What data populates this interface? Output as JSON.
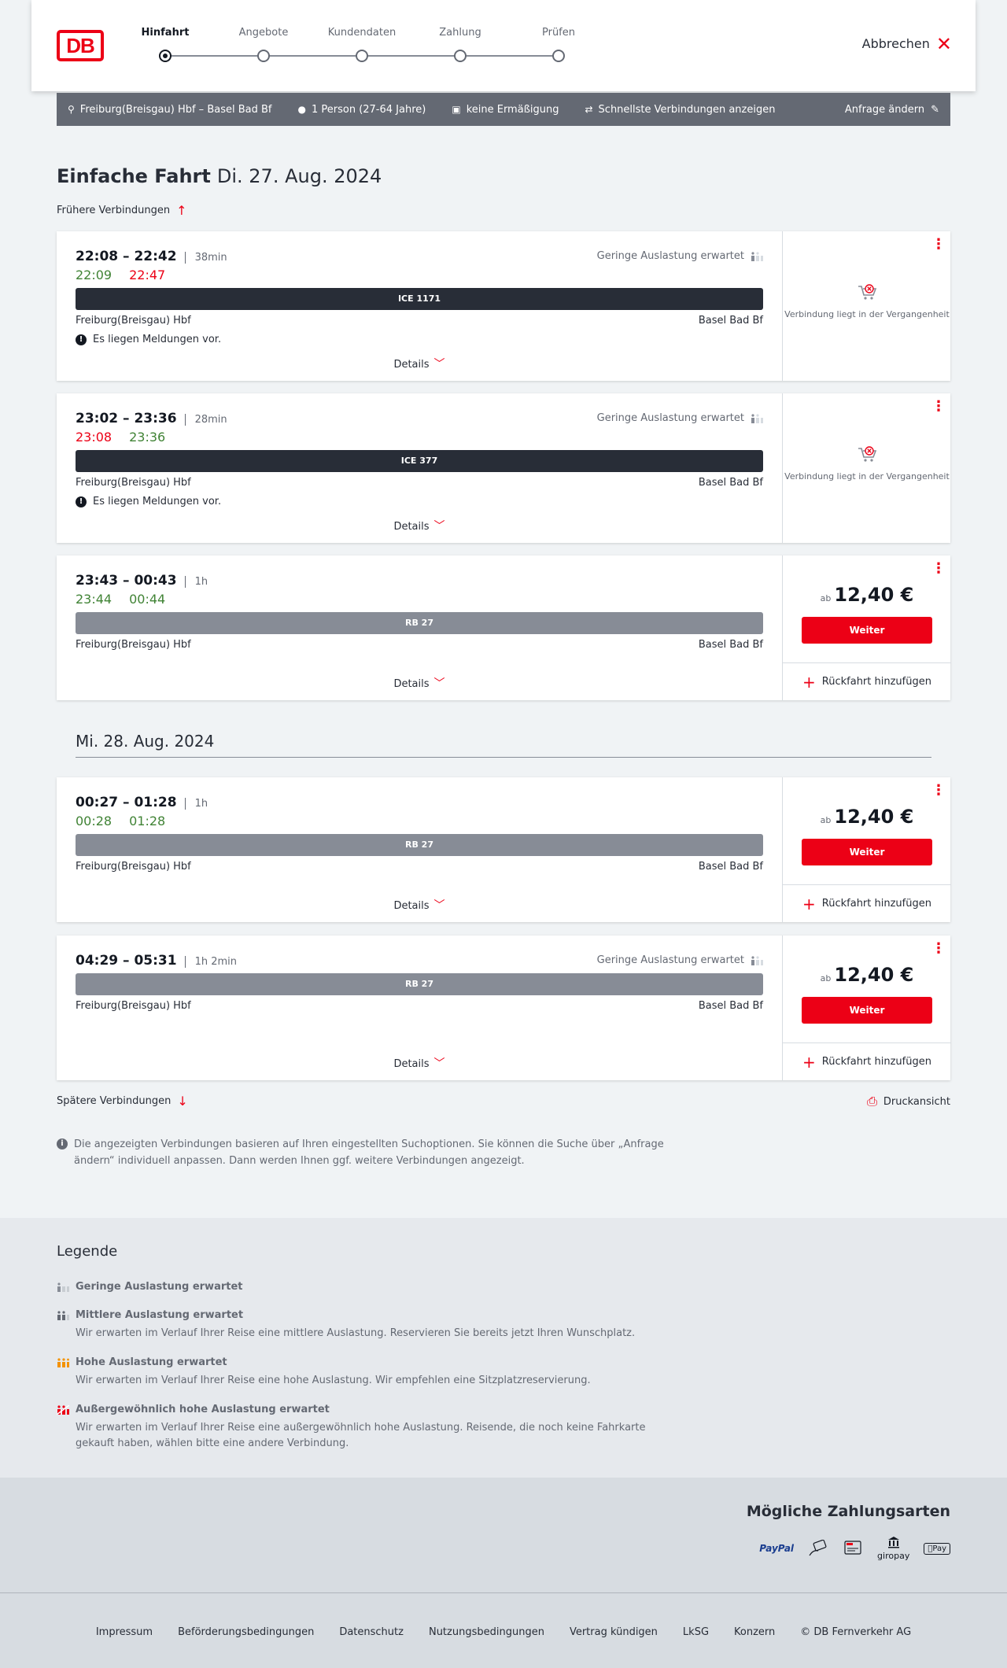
{
  "header": {
    "logo": "DB",
    "steps": [
      "Hinfahrt",
      "Angebote",
      "Kundendaten",
      "Zahlung",
      "Prüfen"
    ],
    "active_step": "Hinfahrt",
    "cancel_label": "Abbrechen"
  },
  "query": {
    "route": "Freiburg(Breisgau) Hbf – Basel Bad Bf",
    "passengers": "1 Person (27-64 Jahre)",
    "discount": "keine Ermäßigung",
    "fastest": "Schnellste Verbindungen anzeigen",
    "change_label": "Anfrage ändern"
  },
  "page": {
    "title": "Einfache Fahrt",
    "date": "Di. 27. Aug. 2024",
    "earlier_label": "Frühere Verbindungen",
    "later_label": "Spätere Verbindungen",
    "print_label": "Druckansicht",
    "day_separator": "Mi. 28. Aug. 2024",
    "note": "Die angezeigten Verbindungen basieren auf Ihren eingestellten Suchoptionen. Sie können die Suche über „Anfrage ändern“ individuell anpassen. Dann werden Ihnen ggf. weitere Verbindungen angezeigt."
  },
  "connections": [
    {
      "times": "22:08 – 22:42",
      "duration": "38min",
      "rt_dep": "22:09",
      "rt_arr": "22:47",
      "rt_dep_color": "green",
      "rt_arr_color": "red",
      "load": "Geringe Auslastung erwartet",
      "train": "ICE 1171",
      "train_type": "ice",
      "from": "Freiburg(Breisgau) Hbf",
      "to": "Basel Bad Bf",
      "message": "Es liegen Meldungen vor.",
      "details": "Details",
      "past": "Verbindung liegt in der Vergangenheit"
    },
    {
      "times": "23:02 – 23:36",
      "duration": "28min",
      "rt_dep": "23:08",
      "rt_arr": "23:36",
      "rt_dep_color": "red",
      "rt_arr_color": "green",
      "load": "Geringe Auslastung erwartet",
      "train": "ICE 377",
      "train_type": "ice",
      "from": "Freiburg(Breisgau) Hbf",
      "to": "Basel Bad Bf",
      "message": "Es liegen Meldungen vor.",
      "details": "Details",
      "past": "Verbindung liegt in der Vergangenheit"
    },
    {
      "times": "23:43 – 00:43",
      "duration": "1h",
      "rt_dep": "23:44",
      "rt_arr": "00:44",
      "rt_dep_color": "green",
      "rt_arr_color": "green",
      "train": "RB 27",
      "train_type": "rb",
      "from": "Freiburg(Breisgau) Hbf",
      "to": "Basel Bad Bf",
      "details": "Details",
      "price_prefix": "ab",
      "price": "12,40 €",
      "button": "Weiter",
      "return": "Rückfahrt hinzufügen"
    },
    {
      "times": "00:27 – 01:28",
      "duration": "1h",
      "rt_dep": "00:28",
      "rt_arr": "01:28",
      "rt_dep_color": "green",
      "rt_arr_color": "green",
      "train": "RB 27",
      "train_type": "rb",
      "from": "Freiburg(Breisgau) Hbf",
      "to": "Basel Bad Bf",
      "details": "Details",
      "price_prefix": "ab",
      "price": "12,40 €",
      "button": "Weiter",
      "return": "Rückfahrt hinzufügen"
    },
    {
      "times": "04:29 – 05:31",
      "duration": "1h 2min",
      "load": "Geringe Auslastung erwartet",
      "train": "RB 27",
      "train_type": "rb",
      "from": "Freiburg(Breisgau) Hbf",
      "to": "Basel Bad Bf",
      "details": "Details",
      "price_prefix": "ab",
      "price": "12,40 €",
      "button": "Weiter",
      "return": "Rückfahrt hinzufügen"
    }
  ],
  "legend": {
    "title": "Legende",
    "items": [
      {
        "title": "Geringe Auslastung erwartet",
        "desc": "",
        "icon_color": "#878c96"
      },
      {
        "title": "Mittlere Auslastung erwartet",
        "desc": "Wir erwarten im Verlauf Ihrer Reise eine mittlere Auslastung. Reservieren Sie bereits jetzt Ihren Wunschplatz.",
        "icon_color": "#646973"
      },
      {
        "title": "Hohe Auslastung erwartet",
        "desc": "Wir erwarten im Verlauf Ihrer Reise eine hohe Auslastung. Wir empfehlen eine Sitzplatzreservierung.",
        "icon_color": "#f39200"
      },
      {
        "title": "Außergewöhnlich hohe Auslastung erwartet",
        "desc": "Wir erwarten im Verlauf Ihrer Reise eine außergewöhnlich hohe Auslastung. Reisende, die noch keine Fahrkarte gekauft haben, wählen bitte eine andere Verbindung.",
        "icon_color": "#ec0016"
      }
    ]
  },
  "payments": {
    "title": "Mögliche Zahlungsarten",
    "methods": [
      "PayPal",
      "giropay",
      "Pay"
    ]
  },
  "footer": {
    "links": [
      "Impressum",
      "Beförderungsbedingungen",
      "Datenschutz",
      "Nutzungsbedingungen",
      "Vertrag kündigen",
      "LkSG",
      "Konzern",
      "© DB Fernverkehr AG"
    ]
  },
  "colors": {
    "accent": "#ec0016",
    "on_time": "#408335",
    "dark": "#282d37"
  }
}
